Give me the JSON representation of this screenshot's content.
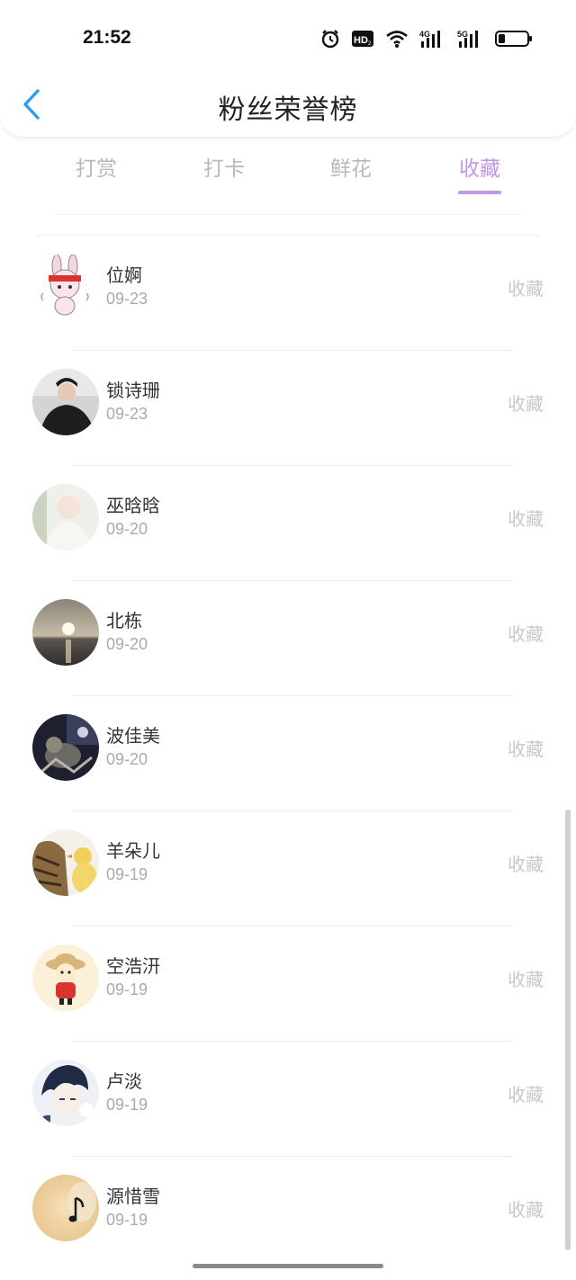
{
  "status": {
    "time": "21:52"
  },
  "header": {
    "title": "粉丝荣誉榜"
  },
  "tabs": [
    {
      "label": "打赏",
      "active": false
    },
    {
      "label": "打卡",
      "active": false
    },
    {
      "label": "鲜花",
      "active": false
    },
    {
      "label": "收藏",
      "active": true
    }
  ],
  "colors": {
    "accent": "#c197e6",
    "back": "#2b9ef4"
  },
  "fans": [
    {
      "name": "位婀",
      "date": "09-23",
      "action": "收藏",
      "avatar": "cartoon-bunny-girl"
    },
    {
      "name": "锁诗珊",
      "date": "09-23",
      "action": "收藏",
      "avatar": "dark-portrait"
    },
    {
      "name": "巫晗晗",
      "date": "09-20",
      "action": "收藏",
      "avatar": "light-portrait"
    },
    {
      "name": "北栋",
      "date": "09-20",
      "action": "收藏",
      "avatar": "sunset-sea"
    },
    {
      "name": "波佳美",
      "date": "09-20",
      "action": "收藏",
      "avatar": "dark-cat"
    },
    {
      "name": "羊朵儿",
      "date": "09-19",
      "action": "收藏",
      "avatar": "cat-and-duckling"
    },
    {
      "name": "空浩汧",
      "date": "09-19",
      "action": "收藏",
      "avatar": "cartoon-boy"
    },
    {
      "name": "卢淡",
      "date": "09-19",
      "action": "收藏",
      "avatar": "anime-boy"
    },
    {
      "name": "源惜雪",
      "date": "09-19",
      "action": "收藏",
      "avatar": "music-note"
    }
  ]
}
